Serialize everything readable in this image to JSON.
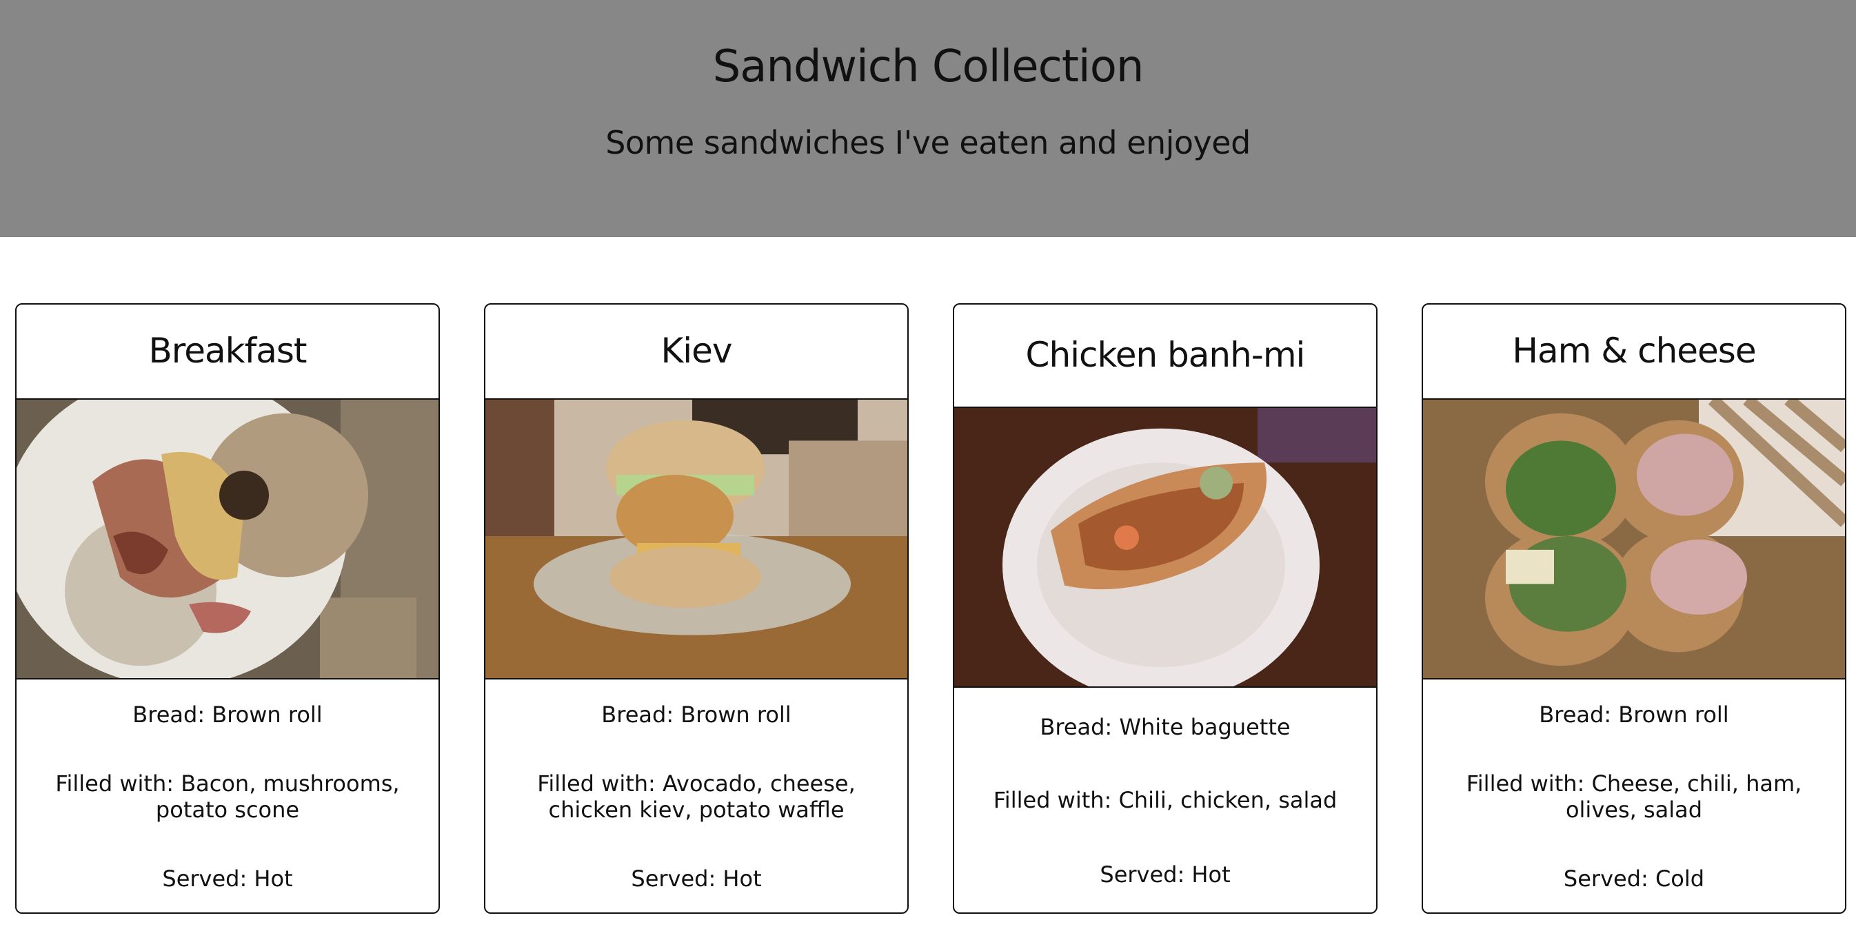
{
  "header": {
    "title": "Sandwich Collection",
    "subtitle": "Some sandwiches I've eaten and enjoyed"
  },
  "cards": [
    {
      "name": "Breakfast",
      "bread": "Bread: Brown roll",
      "filling": "Filled with: Bacon, mushrooms, potato scone",
      "served": "Served: Hot"
    },
    {
      "name": "Kiev",
      "bread": "Bread: Brown roll",
      "filling": "Filled with: Avocado, cheese, chicken kiev, potato waffle",
      "served": "Served: Hot"
    },
    {
      "name": "Chicken banh-mi",
      "bread": "Bread: White baguette",
      "filling": "Filled with: Chili, chicken, salad",
      "served": "Served: Hot"
    },
    {
      "name": "Ham & cheese",
      "bread": "Bread: Brown roll",
      "filling": "Filled with: Cheese, chili, ham, olives, salad",
      "served": "Served: Cold"
    }
  ]
}
